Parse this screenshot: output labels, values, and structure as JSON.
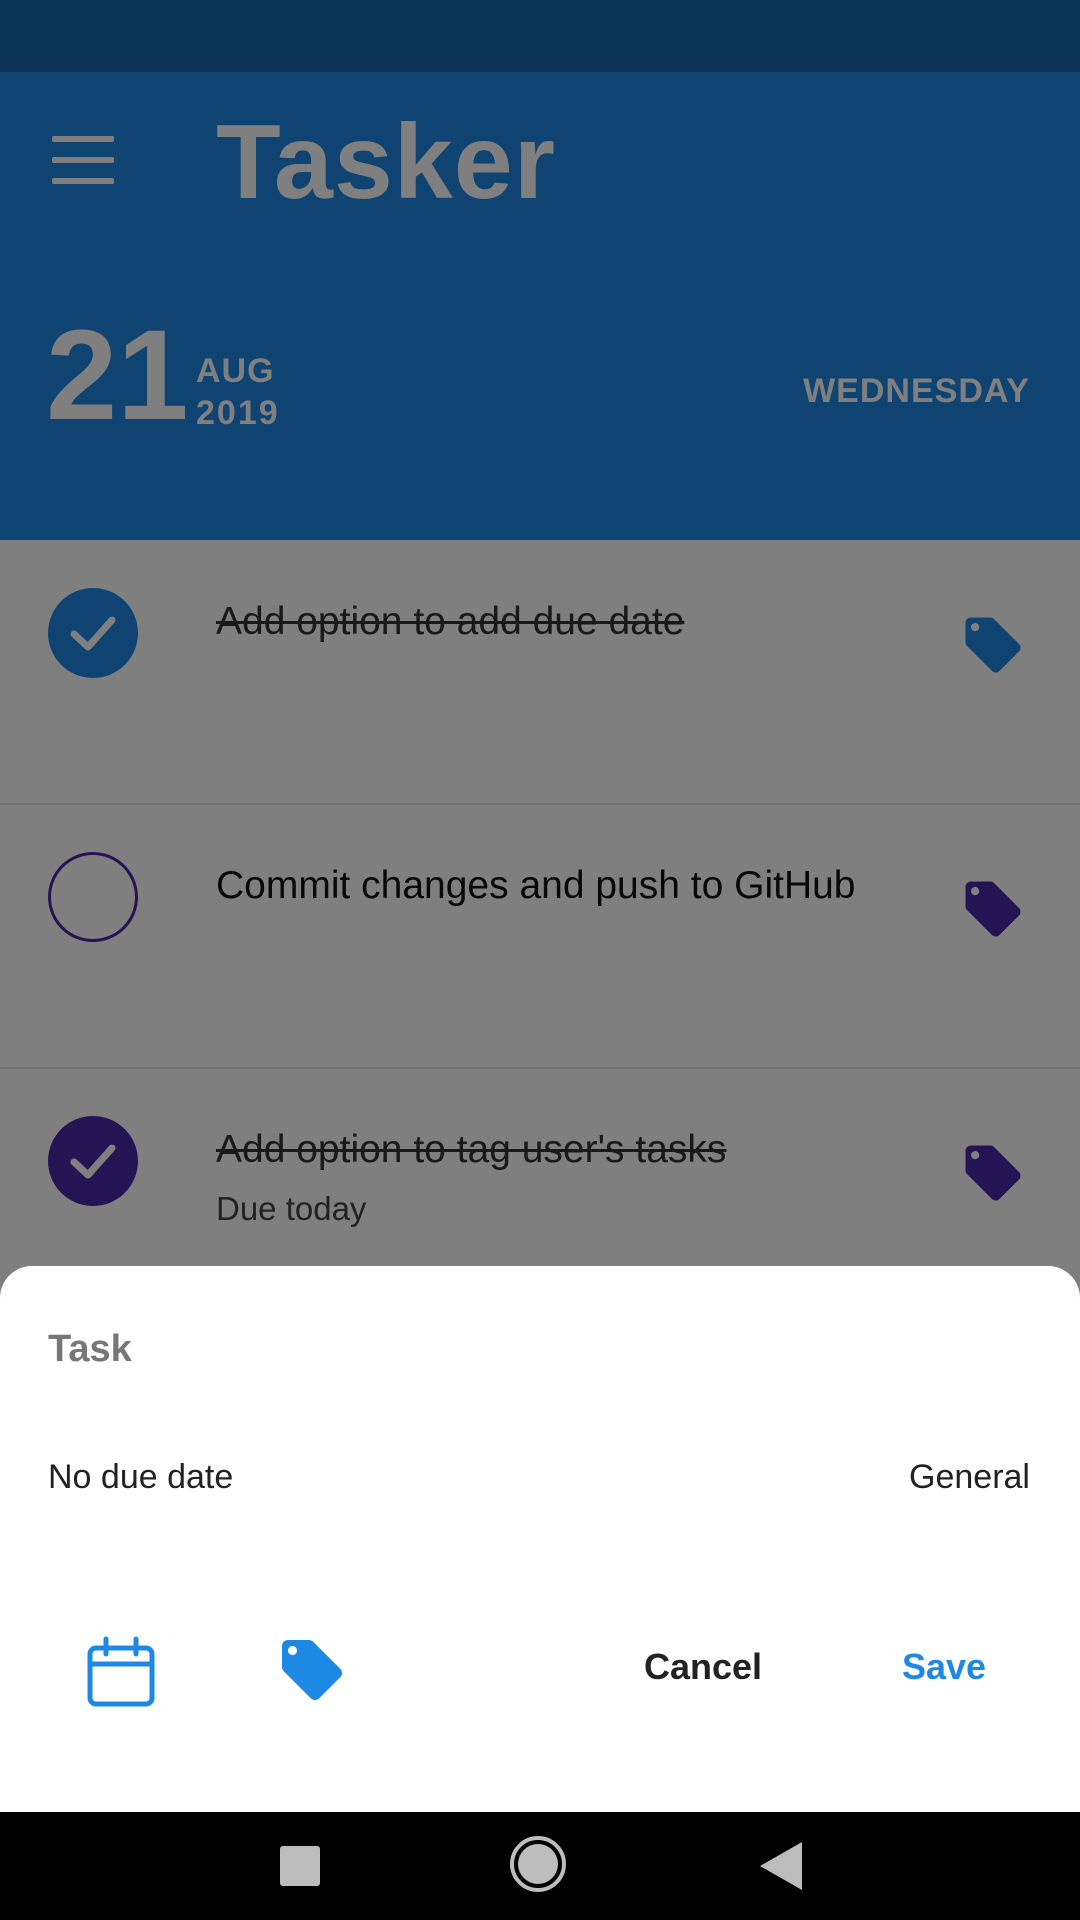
{
  "app": {
    "title": "Tasker",
    "colors": {
      "primary": "#1e88e5",
      "primary_dark": "#1565a8",
      "accent_purple": "#4a28a6",
      "dim_overlay": "rgba(0,0,0,0.5)"
    }
  },
  "header": {
    "day": "21",
    "month": "AUG",
    "year": "2019",
    "weekday": "WEDNESDAY",
    "menu_icon": "hamburger-menu-icon"
  },
  "tasks": [
    {
      "text": "Add option to add due date",
      "done": true,
      "sub": "",
      "tag_color": "#1e88e5",
      "check_color": "#1e88e5"
    },
    {
      "text": "Commit changes and push to GitHub",
      "done": false,
      "sub": "",
      "tag_color": "#4a28a6",
      "check_color": "#4a28a6"
    },
    {
      "text": "Add option to tag user's tasks",
      "done": true,
      "sub": "Due today",
      "tag_color": "#4a28a6",
      "check_color": "#4a28a6"
    }
  ],
  "sheet": {
    "title": "Task",
    "due_label": "No due date",
    "category": "General",
    "calendar_icon": "calendar-icon",
    "tag_icon": "tag-icon",
    "cancel_label": "Cancel",
    "save_label": "Save"
  },
  "navbar": {
    "recents_icon": "recents-square-icon",
    "home_icon": "home-circle-icon",
    "back_icon": "back-triangle-icon"
  }
}
